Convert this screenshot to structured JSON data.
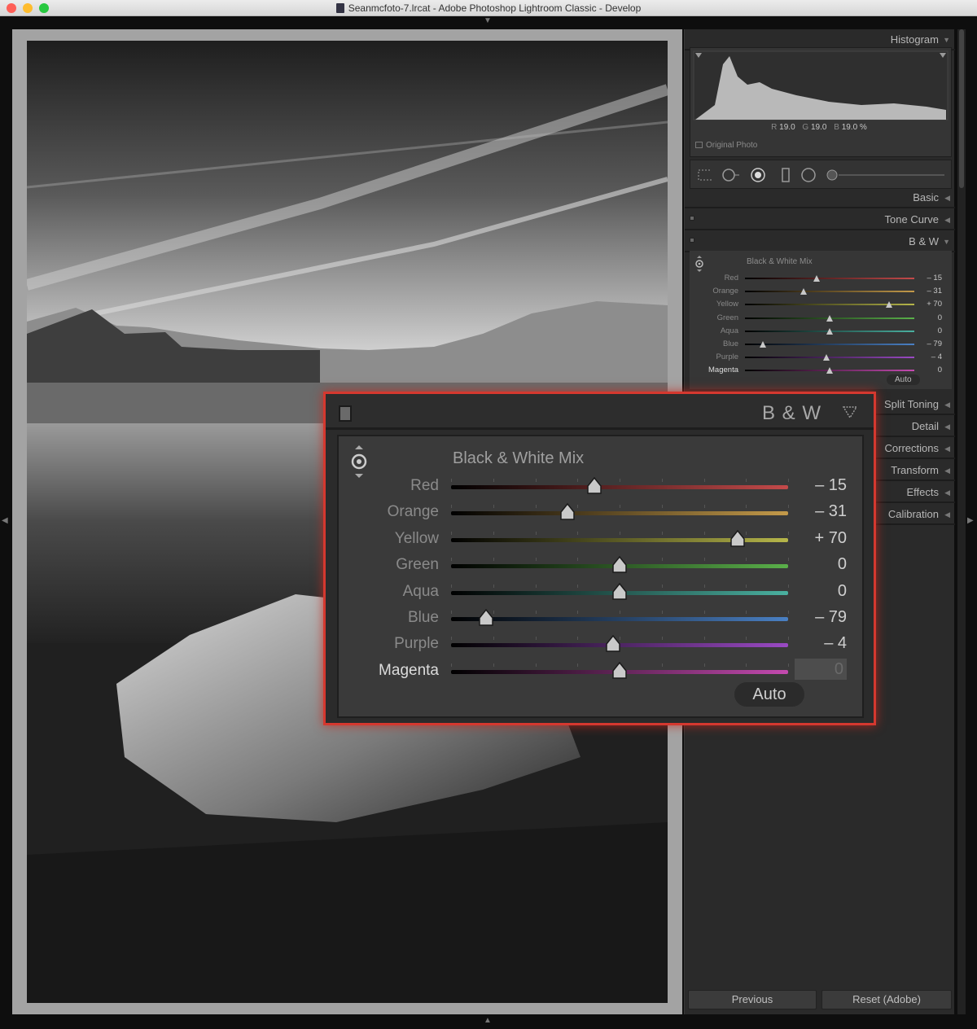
{
  "window": {
    "title": "Seanmcfoto-7.lrcat - Adobe Photoshop Lightroom Classic - Develop",
    "lights": [
      "#fe5f57",
      "#febc2e",
      "#28c840"
    ]
  },
  "histogram": {
    "label": "Histogram",
    "r_label": "R",
    "r": "19.0",
    "g_label": "G",
    "g": "19.0",
    "b_label": "B",
    "b": "19.0 %",
    "original_photo": "Original Photo"
  },
  "panels": {
    "basic": "Basic",
    "tone_curve": "Tone Curve",
    "bw": "B & W",
    "split_toning": "Split Toning",
    "detail": "Detail",
    "corrections": "Corrections",
    "transform": "Transform",
    "effects": "Effects",
    "calibration": "Calibration"
  },
  "bw_mix": {
    "title": "Black & White Mix",
    "auto": "Auto",
    "sliders": [
      {
        "name": "Red",
        "value": "– 15",
        "num": -15,
        "colors": [
          "#000000",
          "#c44a4a"
        ],
        "active": false
      },
      {
        "name": "Orange",
        "value": "– 31",
        "num": -31,
        "colors": [
          "#000000",
          "#c49a4a"
        ],
        "active": false
      },
      {
        "name": "Yellow",
        "value": "+ 70",
        "num": 70,
        "colors": [
          "#000000",
          "#b6b64a"
        ],
        "active": false
      },
      {
        "name": "Green",
        "value": "0",
        "num": 0,
        "colors": [
          "#000000",
          "#5ab04a"
        ],
        "active": false
      },
      {
        "name": "Aqua",
        "value": "0",
        "num": 0,
        "colors": [
          "#000000",
          "#4ab0a0"
        ],
        "active": false
      },
      {
        "name": "Blue",
        "value": "– 79",
        "num": -79,
        "colors": [
          "#000000",
          "#4a80c4"
        ],
        "active": false
      },
      {
        "name": "Purple",
        "value": "– 4",
        "num": -4,
        "colors": [
          "#000000",
          "#9a4ac4"
        ],
        "active": false
      },
      {
        "name": "Magenta",
        "value": "0",
        "num": 0,
        "colors": [
          "#000000",
          "#c44ab0"
        ],
        "active": true
      }
    ]
  },
  "buttons": {
    "previous": "Previous",
    "reset": "Reset (Adobe)"
  },
  "accent": "#d5382f"
}
